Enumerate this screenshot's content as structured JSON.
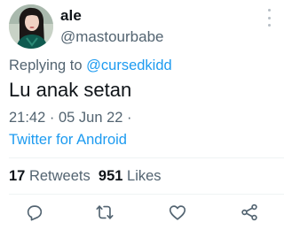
{
  "author": {
    "display_name": "ale",
    "handle": "@mastourbabe",
    "avatar_icon": "profile-photo-icon"
  },
  "reply": {
    "prefix": "Replying to",
    "mention": "@cursedkidd"
  },
  "tweet": {
    "text": "Lu anak setan",
    "meta": "21:42 · 05 Jun 22 ·",
    "source": "Twitter for Android"
  },
  "stats": {
    "retweets_count": "17",
    "retweets_label": "Retweets",
    "likes_count": "951",
    "likes_label": "Likes"
  },
  "actions": [
    {
      "icon": "reply-icon"
    },
    {
      "icon": "retweet-icon"
    },
    {
      "icon": "like-icon"
    },
    {
      "icon": "share-icon"
    }
  ],
  "colors": {
    "link": "#1d9bf0",
    "secondary_text": "#536471",
    "primary_text": "#0f1419",
    "divider": "#eff3f4"
  }
}
